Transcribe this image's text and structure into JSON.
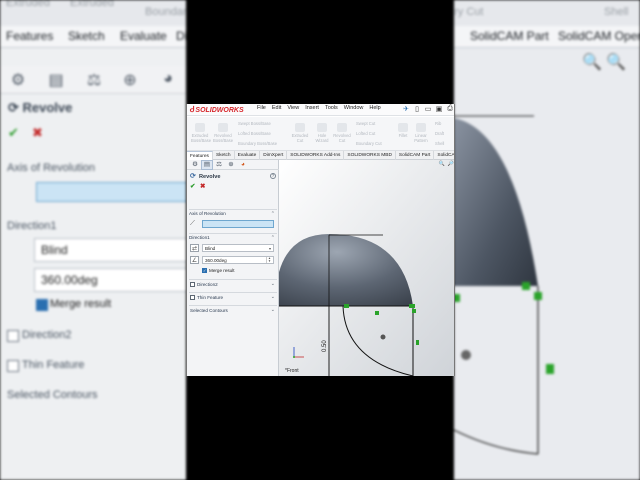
{
  "app": {
    "name": "SOLIDWORKS",
    "brand_color": "#d6262b"
  },
  "menu": [
    "File",
    "Edit",
    "View",
    "Insert",
    "Tools",
    "Window",
    "Help"
  ],
  "quick_access": [
    "pin-icon",
    "new-doc-icon",
    "open-icon",
    "save-icon",
    "print-icon"
  ],
  "commands": {
    "large": [
      "Extruded Boss/Base",
      "Revolved Boss/Base",
      "Extruded Cut",
      "Hole Wizard",
      "Revolved Cut",
      "Fillet",
      "Linear Pattern"
    ],
    "inline": [
      "Swept Boss/Base",
      "Lofted Boss/Base",
      "Boundary Boss/Base",
      "Swept Cut",
      "Lofted Cut",
      "Boundary Cut",
      "Rib",
      "Draft",
      "Shell"
    ]
  },
  "tabs": [
    "Features",
    "Sketch",
    "Evaluate",
    "DimXpert",
    "SOLIDWORKS Add-Ins",
    "SOLIDWORKS MBD",
    "SolidCAM Part",
    "SolidCAM Opera"
  ],
  "active_tab": "Features",
  "property_manager": {
    "title": "Revolve",
    "ok_label": "✔",
    "cancel_label": "✖",
    "axis_section": "Axis of Revolution",
    "direction1_section": "Direction1",
    "end_condition": "Blind",
    "angle": "360.00deg",
    "merge_result_label": "Merge result",
    "merge_result_checked": true,
    "direction2_label": "Direction2",
    "thin_feature_label": "Thin Feature",
    "selected_contours": "Selected Contours",
    "help": "?"
  },
  "graphics": {
    "dimension_label": "0.50",
    "view_name": "*Front"
  },
  "bg": {
    "ribbon_left": [
      "Extruded",
      "Extruded",
      "Boundary"
    ],
    "ribbon_right": [
      "ary Cut",
      "Shell"
    ],
    "tabs_left": [
      "Features",
      "Sketch",
      "Evaluate",
      "Di"
    ],
    "tabs_right": [
      "SolidCAM Part",
      "SolidCAM Opera"
    ]
  }
}
